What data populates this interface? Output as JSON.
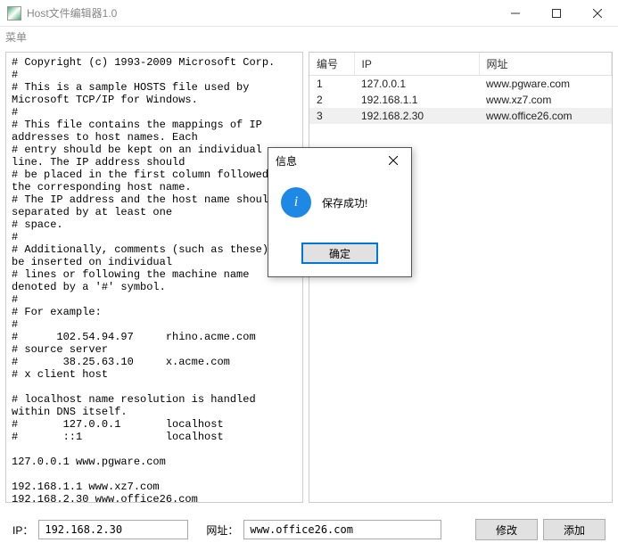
{
  "title": "Host文件编辑器1.0",
  "menu": {
    "label": "菜单"
  },
  "win_controls": {
    "min": "minimize",
    "max": "maximize",
    "close": "close"
  },
  "hosts_text": "# Copyright (c) 1993-2009 Microsoft Corp.\n#\n# This is a sample HOSTS file used by Microsoft TCP/IP for Windows.\n#\n# This file contains the mappings of IP addresses to host names. Each\n# entry should be kept on an individual line. The IP address should\n# be placed in the first column followed by the corresponding host name.\n# The IP address and the host name should be separated by at least one\n# space.\n#\n# Additionally, comments (such as these) may be inserted on individual\n# lines or following the machine name denoted by a '#' symbol.\n#\n# For example:\n#\n#      102.54.94.97     rhino.acme.com          # source server\n#       38.25.63.10     x.acme.com              # x client host\n\n# localhost name resolution is handled within DNS itself.\n#\t127.0.0.1       localhost\n#\t::1             localhost\n\n127.0.0.1 www.pgware.com\n\n192.168.1.1 www.xz7.com\n192.168.2.30 www.office26.com\nwww.baidu.com\nwww.sina.com.cn",
  "table": {
    "headers": {
      "idx": "编号",
      "ip": "IP",
      "url": "网址"
    },
    "rows": [
      {
        "idx": "1",
        "ip": "127.0.0.1",
        "url": "www.pgware.com"
      },
      {
        "idx": "2",
        "ip": "192.168.1.1",
        "url": "www.xz7.com"
      },
      {
        "idx": "3",
        "ip": "192.168.2.30",
        "url": "www.office26.com"
      }
    ],
    "selected": 2
  },
  "form": {
    "ip_label": "IP：",
    "ip_value": "192.168.2.30",
    "url_label": "网址：",
    "url_value": "www.office26.com",
    "modify": "修改",
    "add": "添加"
  },
  "dialog": {
    "title": "信息",
    "message": "保存成功!",
    "ok": "确定"
  }
}
